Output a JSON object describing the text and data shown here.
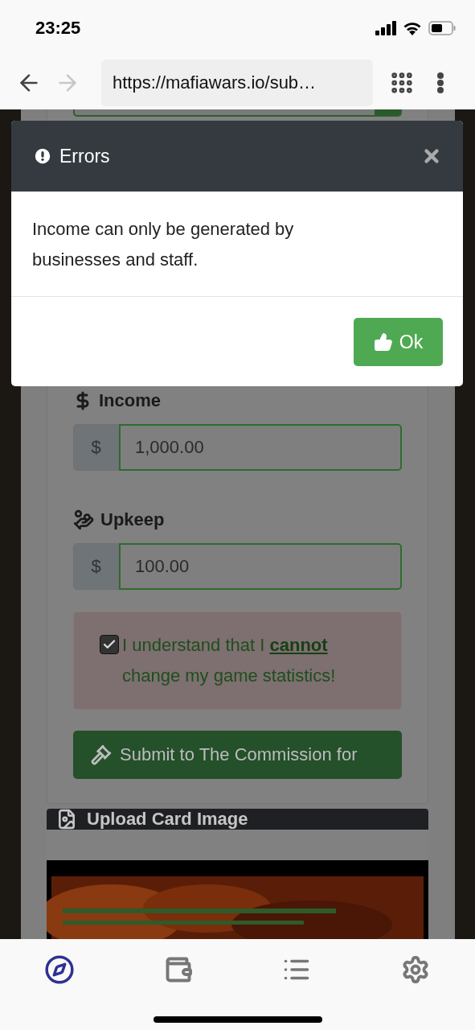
{
  "status_bar": {
    "time": "23:25"
  },
  "browser": {
    "url": "https://mafiawars.io/sub…"
  },
  "form": {
    "fields": [
      {
        "kind": "income",
        "label": "Income",
        "prefix": "$",
        "value": "1,000.00"
      },
      {
        "kind": "upkeep",
        "label": "Upkeep",
        "prefix": "$",
        "value": "100.00"
      }
    ],
    "acknowledge": {
      "text": "I understand that I **cannot** change my game statistics!",
      "checked": true
    },
    "submit_button": "Submit to The Commission for"
  },
  "upload_panel": {
    "title": "Upload Card Image"
  },
  "modal": {
    "title": "Errors",
    "message": "Income can only be generated by businesses and staff.",
    "ok_button": "Ok"
  },
  "tab_bar": {
    "tabs": [
      {
        "kind": "explore",
        "selected": true
      },
      {
        "kind": "wallet",
        "selected": false
      },
      {
        "kind": "list",
        "selected": false
      },
      {
        "kind": "settings",
        "selected": false
      }
    ]
  }
}
